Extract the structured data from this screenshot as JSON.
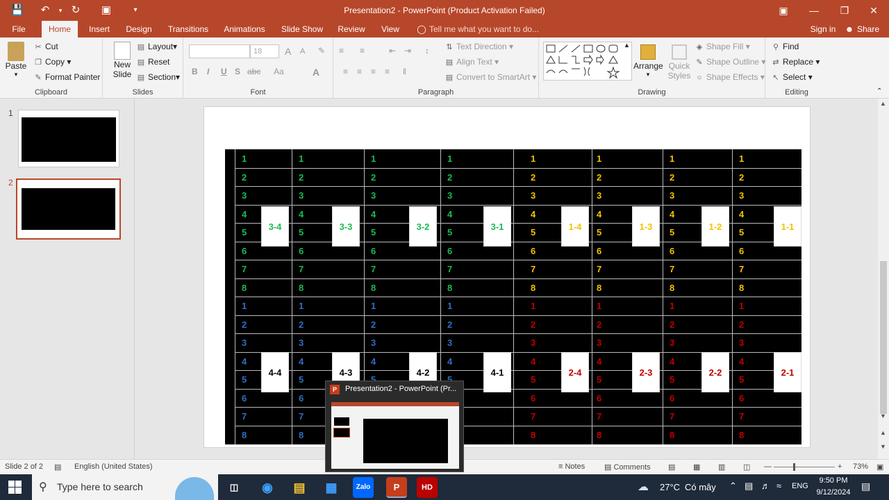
{
  "window": {
    "title": "Presentation2 - PowerPoint (Product Activation Failed)",
    "controls": [
      "ribbon-display-icon",
      "minimize-icon",
      "restore-icon",
      "close-icon"
    ]
  },
  "qat": [
    "save-icon",
    "undo-icon",
    "redo-icon",
    "start-from-beginning-icon",
    "customize-icon"
  ],
  "tabs": [
    "File",
    "Home",
    "Insert",
    "Design",
    "Transitions",
    "Animations",
    "Slide Show",
    "Review",
    "View"
  ],
  "tell_me": "Tell me what you want to do...",
  "signin": "Sign in",
  "share": "Share",
  "ribbon": {
    "clipboard": {
      "paste": "Paste",
      "cut": "Cut",
      "copy": "Copy",
      "format_painter": "Format Painter",
      "label": "Clipboard"
    },
    "slides": {
      "new_slide_1": "New",
      "new_slide_2": "Slide",
      "layout": "Layout",
      "reset": "Reset",
      "section": "Section",
      "label": "Slides"
    },
    "font": {
      "font_size": "18",
      "label": "Font",
      "bold": "B",
      "italic": "I",
      "underline": "U",
      "strike": "S",
      "spacing": "abc",
      "case": "Aa",
      "color": "A",
      "grow": "A",
      "shrink": "A"
    },
    "paragraph": {
      "text_direction": "Text Direction",
      "align_text": "Align Text",
      "smartart": "Convert to SmartArt",
      "label": "Paragraph"
    },
    "drawing": {
      "arrange": "Arrange",
      "quick_styles_1": "Quick",
      "quick_styles_2": "Styles",
      "shape_fill": "Shape Fill",
      "shape_outline": "Shape Outline",
      "shape_effects": "Shape Effects",
      "label": "Drawing"
    },
    "editing": {
      "find": "Find",
      "replace": "Replace",
      "select": "Select",
      "label": "Editing"
    }
  },
  "thumbnails": [
    {
      "num": "1"
    },
    {
      "num": "2"
    }
  ],
  "slide": {
    "row_labels": [
      "1",
      "2",
      "3",
      "4",
      "5",
      "6",
      "7",
      "8",
      "1",
      "2",
      "3",
      "4",
      "5",
      "6",
      "7",
      "8"
    ],
    "left_top_color": "#1db954",
    "left_bottom_color": "#2f6fbd",
    "right_top_color": "#f2c200",
    "right_bottom_color": "#c00000",
    "top_cards": [
      "3-4",
      "3-3",
      "3-2",
      "3-1",
      "1-4",
      "1-3",
      "1-2",
      "1-1"
    ],
    "bottom_cards": [
      "4-4",
      "4-3",
      "4-2",
      "4-1",
      "2-4",
      "2-3",
      "2-2",
      "2-1"
    ]
  },
  "status": {
    "slide_info": "Slide 2 of 2",
    "language": "English (United States)",
    "notes": "Notes",
    "comments": "Comments",
    "zoom": "73%"
  },
  "taskbar": {
    "search_placeholder": "Type here to search",
    "weather_temp": "27°C",
    "weather_desc": "Có mây",
    "lang": "ENG",
    "time": "9:50 PM",
    "date": "9/12/2024",
    "zalo": "Zalo",
    "preview_title": "Presentation2 - PowerPoint (Pr..."
  }
}
